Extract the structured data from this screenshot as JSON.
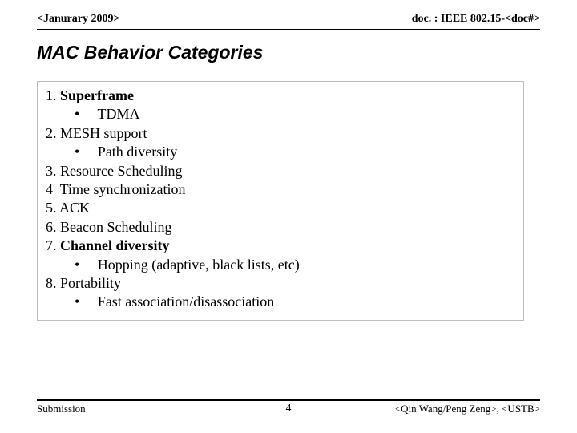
{
  "header": {
    "left": "<Janurary 2009>",
    "right": "doc. : IEEE 802.15-<doc#>"
  },
  "title": "MAC Behavior Categories",
  "content": {
    "l1": "1. ",
    "l1b": "Superframe",
    "l2": "        •     TDMA",
    "l3": "2. MESH support",
    "l4": "        •     Path diversity",
    "l5": "3. Resource Scheduling",
    "l6": "4  Time synchronization",
    "l7": "5. ACK",
    "l8": "6. Beacon Scheduling",
    "l9": "7. ",
    "l9b": "Channel diversity",
    "l10": "        •     Hopping (adaptive, black lists, etc)",
    "l11": "8. Portability",
    "l12": "        •     Fast association/disassociation"
  },
  "footer": {
    "left": "Submission",
    "center": "4",
    "right": "<Qin Wang/Peng Zeng>, <USTB>"
  }
}
